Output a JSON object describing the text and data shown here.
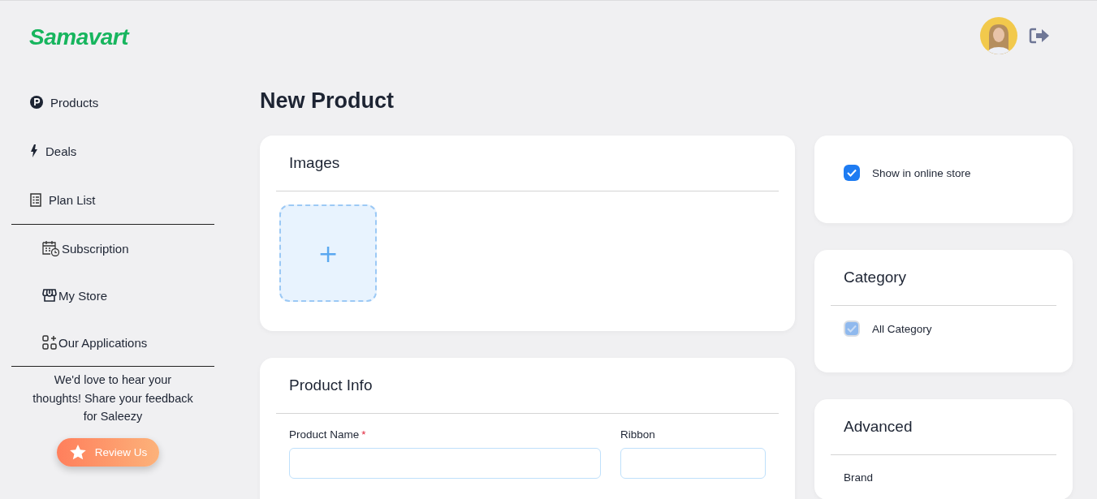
{
  "logo": {
    "text": "Samavart"
  },
  "sidebar": {
    "groups": [
      {
        "items": [
          {
            "label": "Products"
          },
          {
            "label": "Deals"
          },
          {
            "label": "Plan List"
          }
        ]
      },
      {
        "items": [
          {
            "label": "Subscription"
          },
          {
            "label": "My Store"
          },
          {
            "label": "Our Applications"
          }
        ]
      }
    ],
    "feedback": "We'd love to hear your thoughts! Share your feedback for Saleezy",
    "review_button": "Review Us"
  },
  "page_title": "New Product",
  "images_card": {
    "title": "Images",
    "upload_button": "+"
  },
  "product_info": {
    "title": "Product Info",
    "fields": [
      {
        "label": "Product Name",
        "required_mark": "*"
      },
      {
        "label": "Ribbon"
      }
    ]
  },
  "visibility_card": {
    "label": "Show in online store",
    "checked": true
  },
  "category_card": {
    "title": "Category",
    "items": [
      {
        "label": "All Category",
        "checked": true,
        "disabled": true
      }
    ]
  },
  "advanced_card": {
    "title": "Advanced",
    "fields": [
      {
        "label": "Brand"
      }
    ]
  }
}
